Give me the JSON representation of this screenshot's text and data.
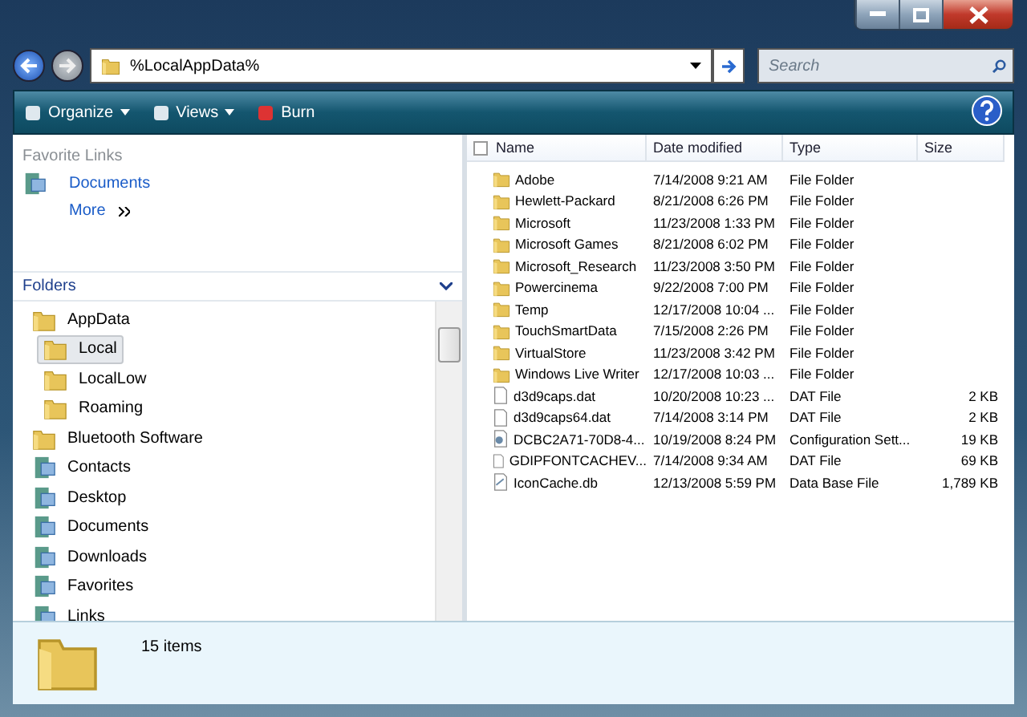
{
  "address_bar": {
    "path": "%LocalAppData%"
  },
  "search": {
    "placeholder": "Search"
  },
  "toolbar": [
    "Organize",
    "Views",
    "Burn"
  ],
  "favorite_links": {
    "title": "Favorite Links",
    "items": [
      "Documents"
    ],
    "more": "More"
  },
  "folders": {
    "title": "Folders",
    "tree": [
      {
        "label": "AppData",
        "kind": "folder",
        "selected": false,
        "children": [
          {
            "label": "Local",
            "kind": "folder",
            "selected": true
          },
          {
            "label": "LocalLow",
            "kind": "folder",
            "selected": false
          },
          {
            "label": "Roaming",
            "kind": "folder",
            "selected": false
          }
        ]
      },
      {
        "label": "Bluetooth Software",
        "kind": "folder",
        "selected": false
      },
      {
        "label": "Contacts",
        "kind": "special",
        "selected": false
      },
      {
        "label": "Desktop",
        "kind": "special",
        "selected": false
      },
      {
        "label": "Documents",
        "kind": "special",
        "selected": false
      },
      {
        "label": "Downloads",
        "kind": "special",
        "selected": false
      },
      {
        "label": "Favorites",
        "kind": "special",
        "selected": false
      },
      {
        "label": "Links",
        "kind": "special",
        "selected": false
      }
    ]
  },
  "table": {
    "columns": [
      "Name",
      "Date modified",
      "Type",
      "Size"
    ],
    "rows": [
      {
        "kind": "folder",
        "name": "Adobe",
        "date": "7/14/2008 9:21 AM",
        "type": "File Folder"
      },
      {
        "kind": "folder",
        "name": "Hewlett-Packard",
        "date": "8/21/2008 6:26 PM",
        "type": "File Folder"
      },
      {
        "kind": "folder",
        "name": "Microsoft",
        "date": "11/23/2008 1:33 PM",
        "type": "File Folder"
      },
      {
        "kind": "folder",
        "name": "Microsoft Games",
        "date": "8/21/2008 6:02 PM",
        "type": "File Folder"
      },
      {
        "kind": "folder",
        "name": "Microsoft_Research",
        "date": "11/23/2008 3:50 PM",
        "type": "File Folder"
      },
      {
        "kind": "folder",
        "name": "Powercinema",
        "date": "9/22/2008 7:00 PM",
        "type": "File Folder"
      },
      {
        "kind": "folder",
        "name": "Temp",
        "date": "12/17/2008 10:04 ...",
        "type": "File Folder"
      },
      {
        "kind": "folder",
        "name": "TouchSmartData",
        "date": "7/15/2008 2:26 PM",
        "type": "File Folder"
      },
      {
        "kind": "folder",
        "name": "VirtualStore",
        "date": "11/23/2008 3:42 PM",
        "type": "File Folder"
      },
      {
        "kind": "folder",
        "name": "Windows Live Writer",
        "date": "12/17/2008 10:03 ...",
        "type": "File Folder"
      },
      {
        "kind": "file",
        "name": "d3d9caps.dat",
        "date": "10/20/2008 10:23 ...",
        "type": "DAT File",
        "size": "2 KB"
      },
      {
        "kind": "file",
        "name": "d3d9caps64.dat",
        "date": "7/14/2008 3:14 PM",
        "type": "DAT File",
        "size": "2 KB"
      },
      {
        "kind": "config",
        "name": "DCBC2A71-70D8-4...",
        "date": "10/19/2008 8:24 PM",
        "type": "Configuration Sett...",
        "size": "19 KB"
      },
      {
        "kind": "file",
        "name": "GDIPFONTCACHEV...",
        "date": "7/14/2008 9:34 AM",
        "type": "DAT File",
        "size": "69 KB"
      },
      {
        "kind": "db",
        "name": "IconCache.db",
        "date": "12/13/2008 5:59 PM",
        "type": "Data Base File",
        "size": "1,789 KB"
      }
    ]
  },
  "status_bar": {
    "count": "15 items"
  }
}
